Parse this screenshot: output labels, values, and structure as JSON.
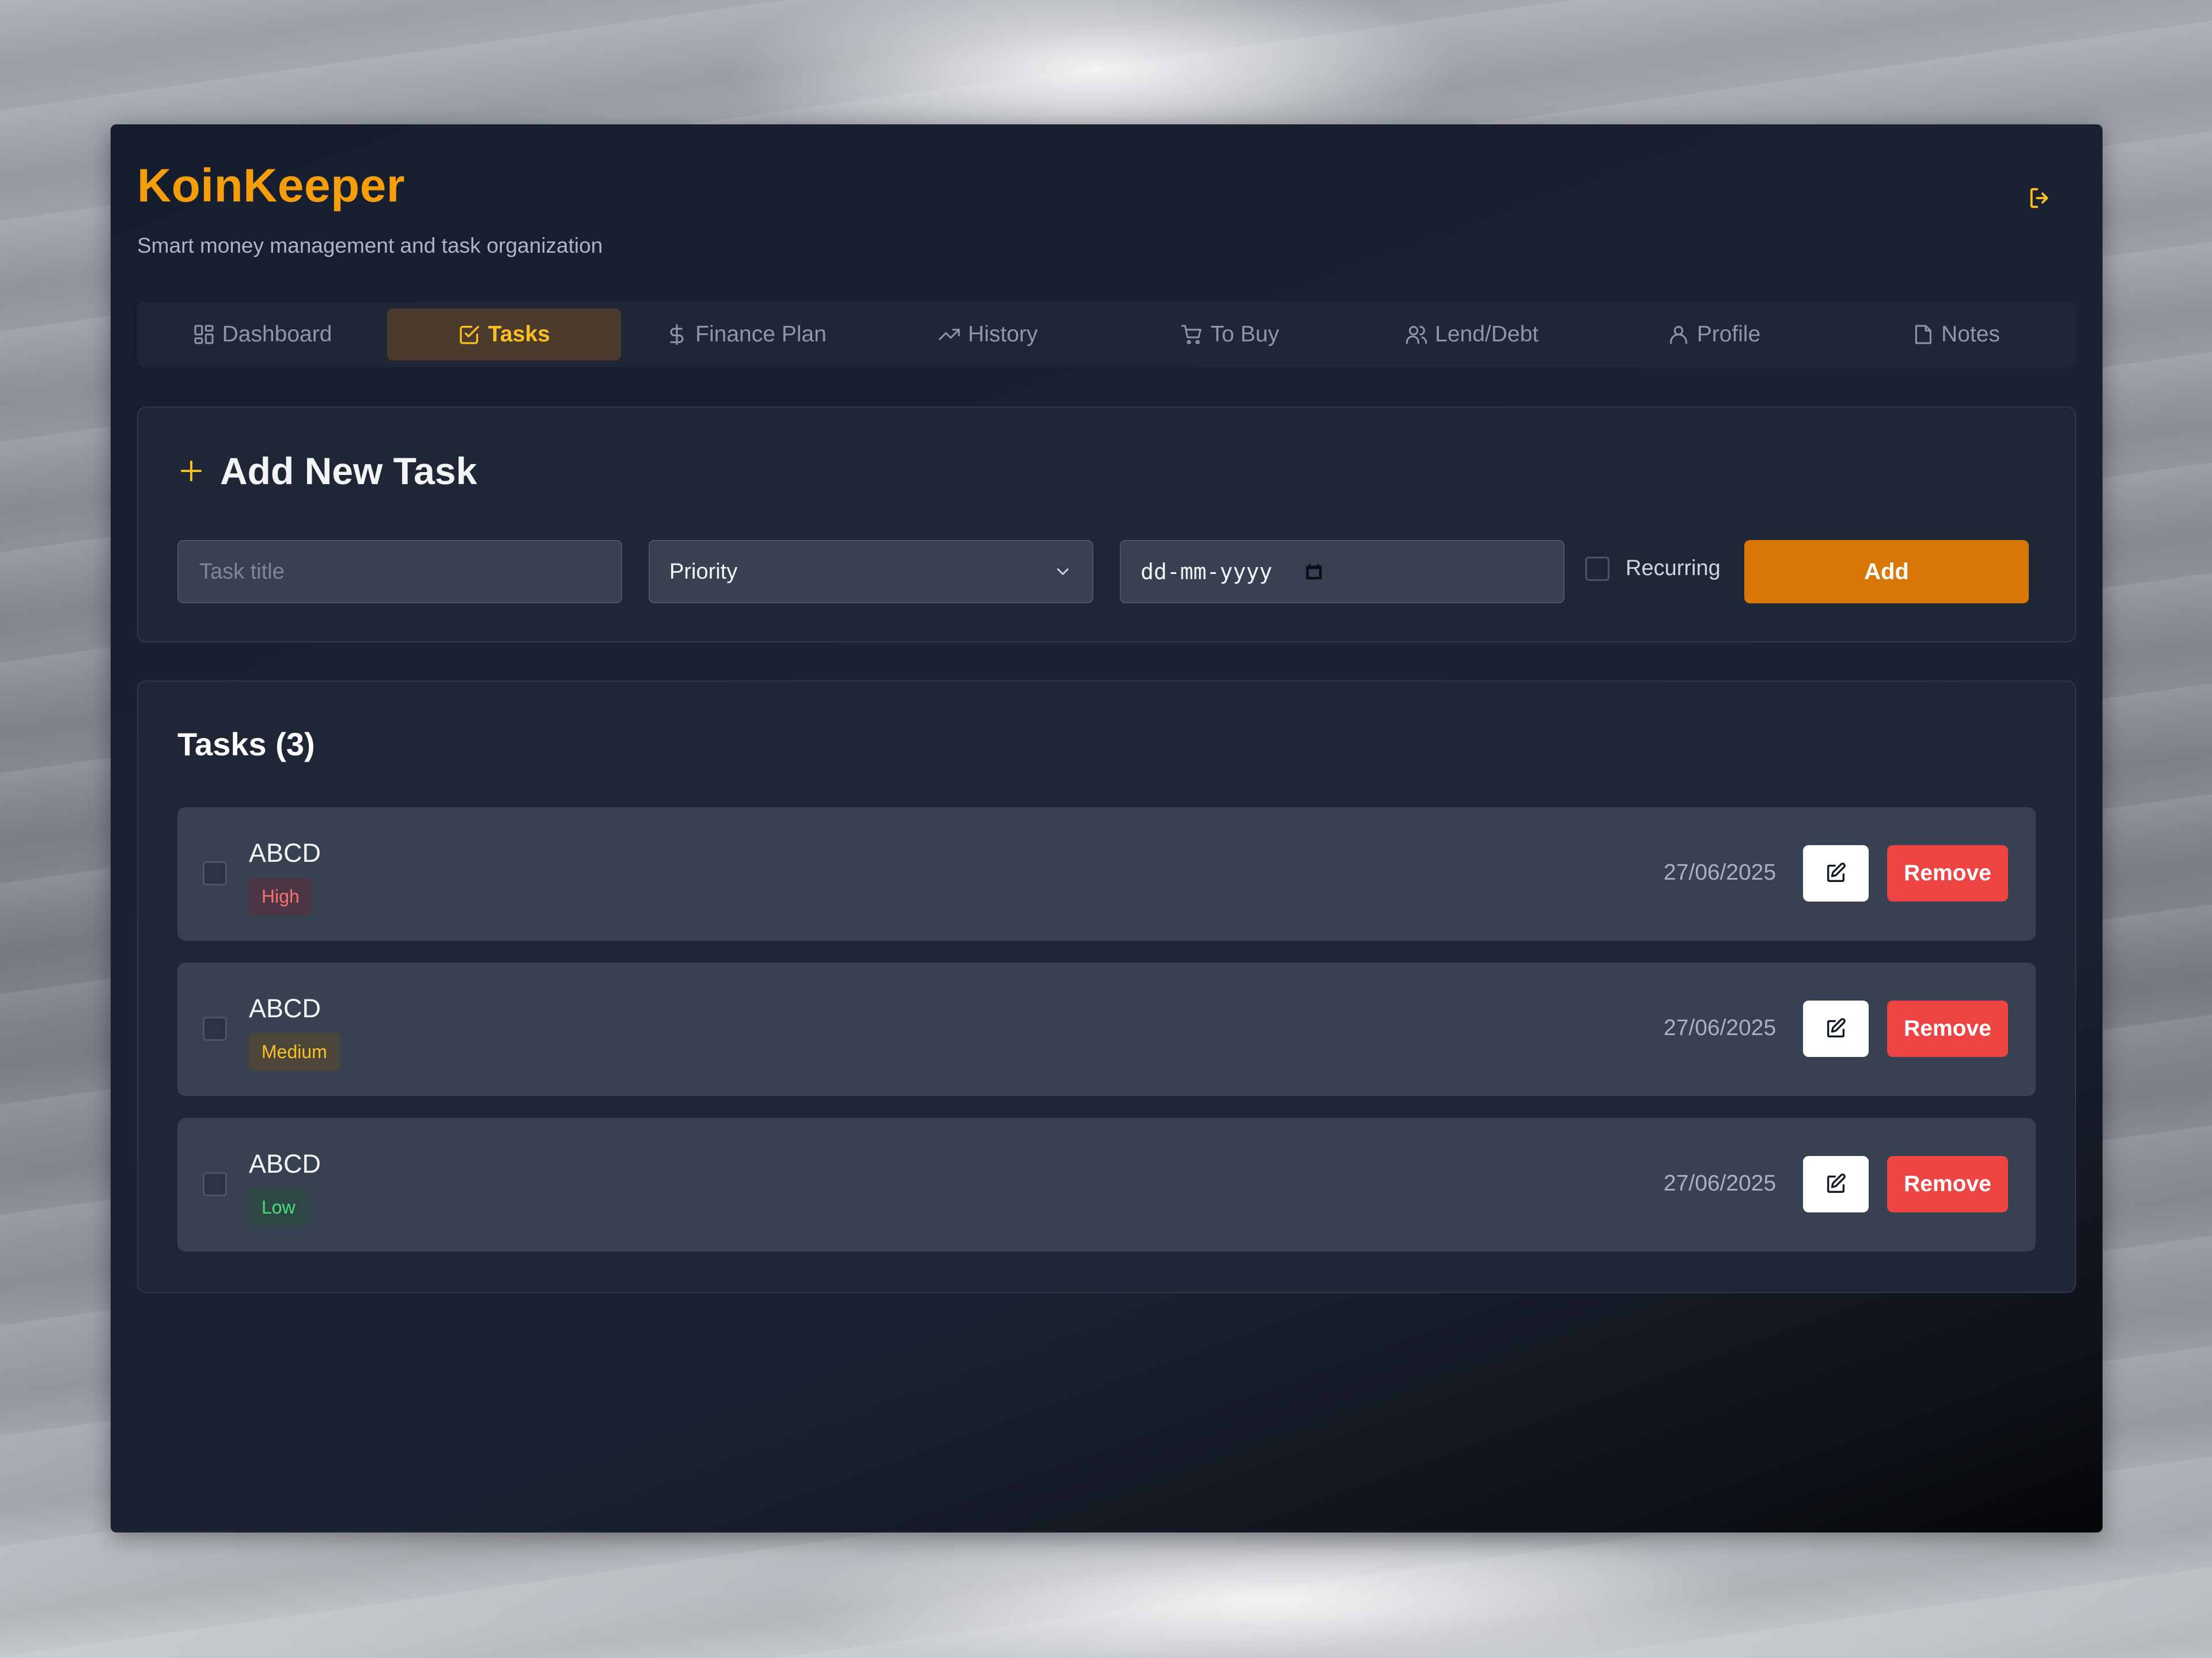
{
  "app": {
    "title": "KoinKeeper",
    "subtitle": "Smart money management and task organization",
    "accent_color": "#f59e0b",
    "logout_icon": "logout-icon"
  },
  "nav": {
    "tabs": [
      {
        "label": "Dashboard",
        "icon": "dashboard-icon",
        "active": false
      },
      {
        "label": "Tasks",
        "icon": "checkbox-icon",
        "active": true
      },
      {
        "label": "Finance Plan",
        "icon": "dollar-icon",
        "active": false
      },
      {
        "label": "History",
        "icon": "trending-up-icon",
        "active": false
      },
      {
        "label": "To Buy",
        "icon": "cart-icon",
        "active": false
      },
      {
        "label": "Lend/Debt",
        "icon": "users-icon",
        "active": false
      },
      {
        "label": "Profile",
        "icon": "user-icon",
        "active": false
      },
      {
        "label": "Notes",
        "icon": "note-icon",
        "active": false
      }
    ]
  },
  "add_task": {
    "heading": "Add New Task",
    "title_placeholder": "Task title",
    "title_value": "",
    "priority_value": "Priority",
    "date_value": "dd-mm-yyyy",
    "recurring_label": "Recurring",
    "recurring_checked": false,
    "add_label": "Add",
    "add_color": "#d97706"
  },
  "task_list": {
    "heading": "Tasks (3)",
    "edit_icon": "edit-icon",
    "remove_label": "Remove",
    "remove_color": "#ef4444",
    "tasks": [
      {
        "title": "ABCD",
        "priority": "High",
        "priority_color": "#f87171",
        "date": "27/06/2025",
        "done": false
      },
      {
        "title": "ABCD",
        "priority": "Medium",
        "priority_color": "#fbbf24",
        "date": "27/06/2025",
        "done": false
      },
      {
        "title": "ABCD",
        "priority": "Low",
        "priority_color": "#4ade80",
        "date": "27/06/2025",
        "done": false
      }
    ]
  }
}
